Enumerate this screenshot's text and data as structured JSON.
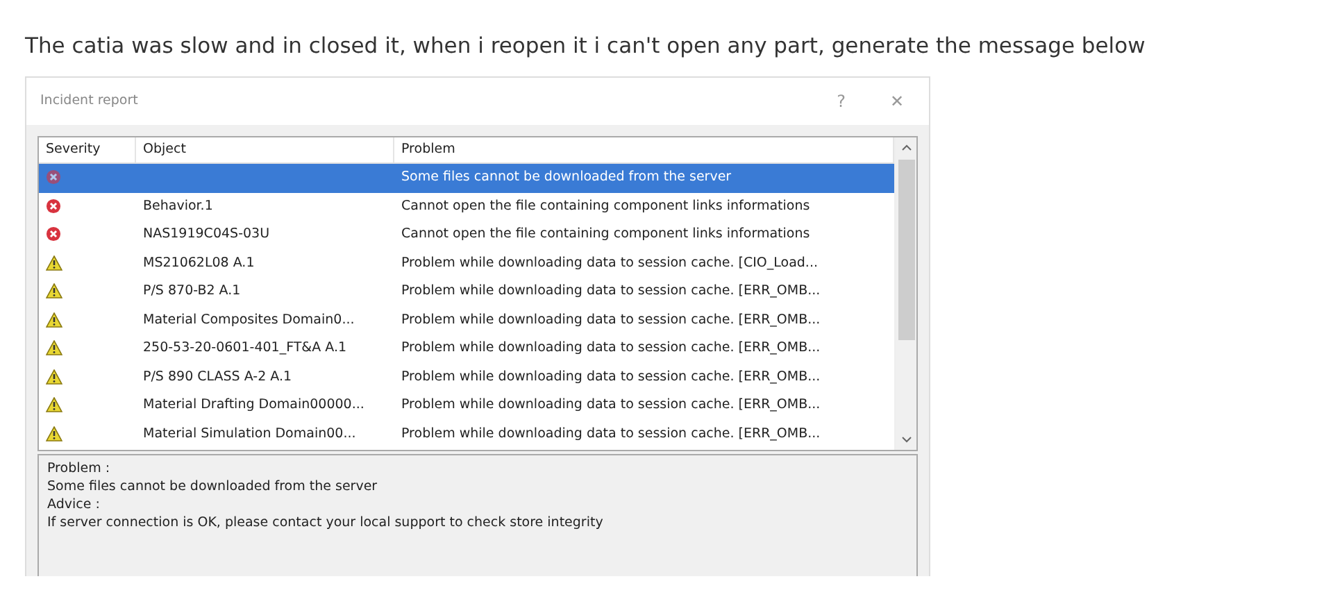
{
  "caption": "The catia was slow and in closed it, when i reopen it i can't open any part, generate the message below",
  "window": {
    "title": "Incident report",
    "help": "?",
    "close": "✕"
  },
  "table": {
    "columns": [
      "Severity",
      "Object",
      "Problem"
    ],
    "rows": [
      {
        "kind": "error",
        "object": "",
        "problem": "Some files cannot be downloaded from the server",
        "selected": true
      },
      {
        "kind": "error",
        "object": "Behavior.1",
        "problem": "Cannot open the file containing component links informations",
        "selected": false
      },
      {
        "kind": "error",
        "object": "NAS1919C04S-03U",
        "problem": "Cannot open the file containing component links informations",
        "selected": false
      },
      {
        "kind": "warning",
        "object": "MS21062L08 A.1",
        "problem": "Problem while downloading data to session cache. [CIO_Load...",
        "selected": false
      },
      {
        "kind": "warning",
        "object": "P/S 870-B2 A.1",
        "problem": "Problem while downloading data to session cache. [ERR_OMB...",
        "selected": false
      },
      {
        "kind": "warning",
        "object": "Material Composites Domain0...",
        "problem": "Problem while downloading data to session cache. [ERR_OMB...",
        "selected": false
      },
      {
        "kind": "warning",
        "object": "250-53-20-0601-401_FT&A A.1",
        "problem": "Problem while downloading data to session cache. [ERR_OMB...",
        "selected": false
      },
      {
        "kind": "warning",
        "object": "P/S 890 CLASS A-2 A.1",
        "problem": "Problem while downloading data to session cache. [ERR_OMB...",
        "selected": false
      },
      {
        "kind": "warning",
        "object": "Material Drafting Domain00000...",
        "problem": "Problem while downloading data to session cache. [ERR_OMB...",
        "selected": false
      },
      {
        "kind": "warning",
        "object": "Material Simulation Domain00...",
        "problem": "Problem while downloading data to session cache. [ERR_OMB...",
        "selected": false
      }
    ]
  },
  "details": [
    "Problem :",
    "Some files cannot be downloaded from the server",
    "Advice :",
    "If server connection is OK, please contact your local support to check store integrity"
  ]
}
